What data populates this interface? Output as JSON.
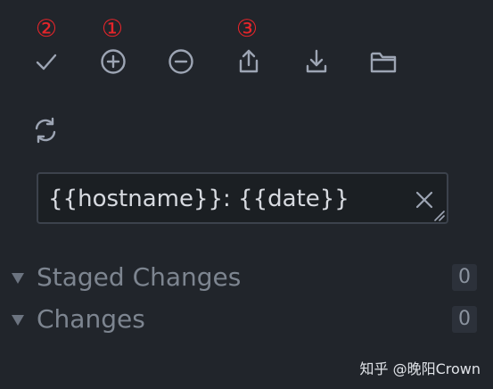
{
  "annotations": {
    "commit": "②",
    "stage_all": "①",
    "push": "③"
  },
  "toolbar": {
    "icons": [
      "check-icon",
      "plus-circle-icon",
      "minus-circle-icon",
      "upload-icon",
      "download-icon",
      "folder-icon",
      "refresh-icon"
    ]
  },
  "commit_message": {
    "value": "{{hostname}}: {{date}}"
  },
  "sections": [
    {
      "label": "Staged Changes",
      "count": "0"
    },
    {
      "label": "Changes",
      "count": "0"
    }
  ],
  "watermark": "知乎 @晚阳Crown",
  "colors": {
    "background": "#21252b",
    "annotation_red": "#e5252a",
    "icon": "#9da5b4",
    "input_background": "#1b1f23",
    "input_border": "#3c424c"
  }
}
